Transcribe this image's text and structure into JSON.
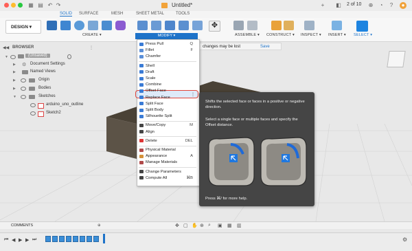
{
  "window": {
    "title": "Untitled*",
    "page_indicator": "2 of 10",
    "traffic_lights": [
      "#ff5f57",
      "#febc2e",
      "#28c840"
    ]
  },
  "tabs": [
    {
      "label": "SOLID",
      "active": true
    },
    {
      "label": "SURFACE"
    },
    {
      "label": "MESH"
    },
    {
      "label": "SHEET METAL"
    },
    {
      "label": "TOOLS"
    }
  ],
  "toolbar": {
    "workspace": "DESIGN",
    "groups": {
      "create": "CREATE",
      "modify": "MODIFY",
      "assemble": "ASSEMBLE",
      "construct": "CONSTRUCT",
      "inspect": "INSPECT",
      "insert": "INSERT",
      "select": "SELECT"
    }
  },
  "notification": {
    "text": "changes may be lost",
    "save": "Save"
  },
  "browser": {
    "title": "BROWSER",
    "root": "(Unsaved)",
    "items": [
      {
        "label": "Document Settings"
      },
      {
        "label": "Named Views"
      },
      {
        "label": "Origin"
      },
      {
        "label": "Bodies"
      },
      {
        "label": "Sketches"
      },
      {
        "label": "arduino_uno_outline"
      },
      {
        "label": "Sketch2"
      }
    ]
  },
  "modify_menu": {
    "items": [
      {
        "label": "Press Pull",
        "shortcut": "Q",
        "icon": "press-pull-icon",
        "color": "#3a7bd5"
      },
      {
        "label": "Fillet",
        "shortcut": "F",
        "icon": "fillet-icon",
        "color": "#5a8fd8"
      },
      {
        "label": "Chamfer",
        "shortcut": "",
        "icon": "chamfer-icon",
        "color": "#5a8fd8"
      },
      {
        "label": "Shell",
        "shortcut": "",
        "icon": "shell-icon",
        "color": "#3a7bd5"
      },
      {
        "label": "Draft",
        "shortcut": "",
        "icon": "draft-icon",
        "color": "#3a7bd5"
      },
      {
        "label": "Scale",
        "shortcut": "",
        "icon": "scale-icon",
        "color": "#3a7bd5"
      },
      {
        "label": "Combine",
        "shortcut": "",
        "icon": "combine-icon",
        "color": "#3a7bd5"
      },
      {
        "label": "Offset Face",
        "shortcut": "",
        "icon": "offset-face-icon",
        "color": "#3a7bd5",
        "highlighted": true
      },
      {
        "label": "Replace Face",
        "shortcut": "",
        "icon": "replace-face-icon",
        "color": "#3a7bd5"
      },
      {
        "label": "Split Face",
        "shortcut": "",
        "icon": "split-face-icon",
        "color": "#3a7bd5"
      },
      {
        "label": "Split Body",
        "shortcut": "",
        "icon": "split-body-icon",
        "color": "#3a7bd5"
      },
      {
        "label": "Silhouette Split",
        "shortcut": "",
        "icon": "silhouette-split-icon",
        "color": "#3a7bd5"
      },
      {
        "label": "Move/Copy",
        "shortcut": "M",
        "icon": "move-copy-icon",
        "color": "#444"
      },
      {
        "label": "Align",
        "shortcut": "",
        "icon": "align-icon",
        "color": "#444"
      },
      {
        "label": "Delete",
        "shortcut": "DEL",
        "icon": "delete-icon",
        "color": "#d33"
      },
      {
        "label": "Physical Material",
        "shortcut": "",
        "icon": "physical-material-icon",
        "color": "#b04a4a"
      },
      {
        "label": "Appearance",
        "shortcut": "A",
        "icon": "appearance-icon",
        "color": "#d4913a"
      },
      {
        "label": "Manage Materials",
        "shortcut": "",
        "icon": "manage-materials-icon",
        "color": "#b04a4a"
      },
      {
        "label": "Change Parameters",
        "shortcut": "",
        "icon": "change-parameters-icon",
        "color": "#444"
      },
      {
        "label": "Compute All",
        "shortcut": "⌘B",
        "icon": "compute-all-icon",
        "color": "#444"
      }
    ]
  },
  "tooltip": {
    "line1": "Shifts the selected face or faces in a positive or negative direction.",
    "line2": "Select a single face or multiple faces and specify the Offset distance.",
    "help": "Press ⌘/ for more help."
  },
  "comments": {
    "label": "COMMENTS"
  },
  "colors": {
    "accent": "#1e73c9",
    "highlight_border": "#e0453a",
    "tooltip_bg": "#454545"
  }
}
